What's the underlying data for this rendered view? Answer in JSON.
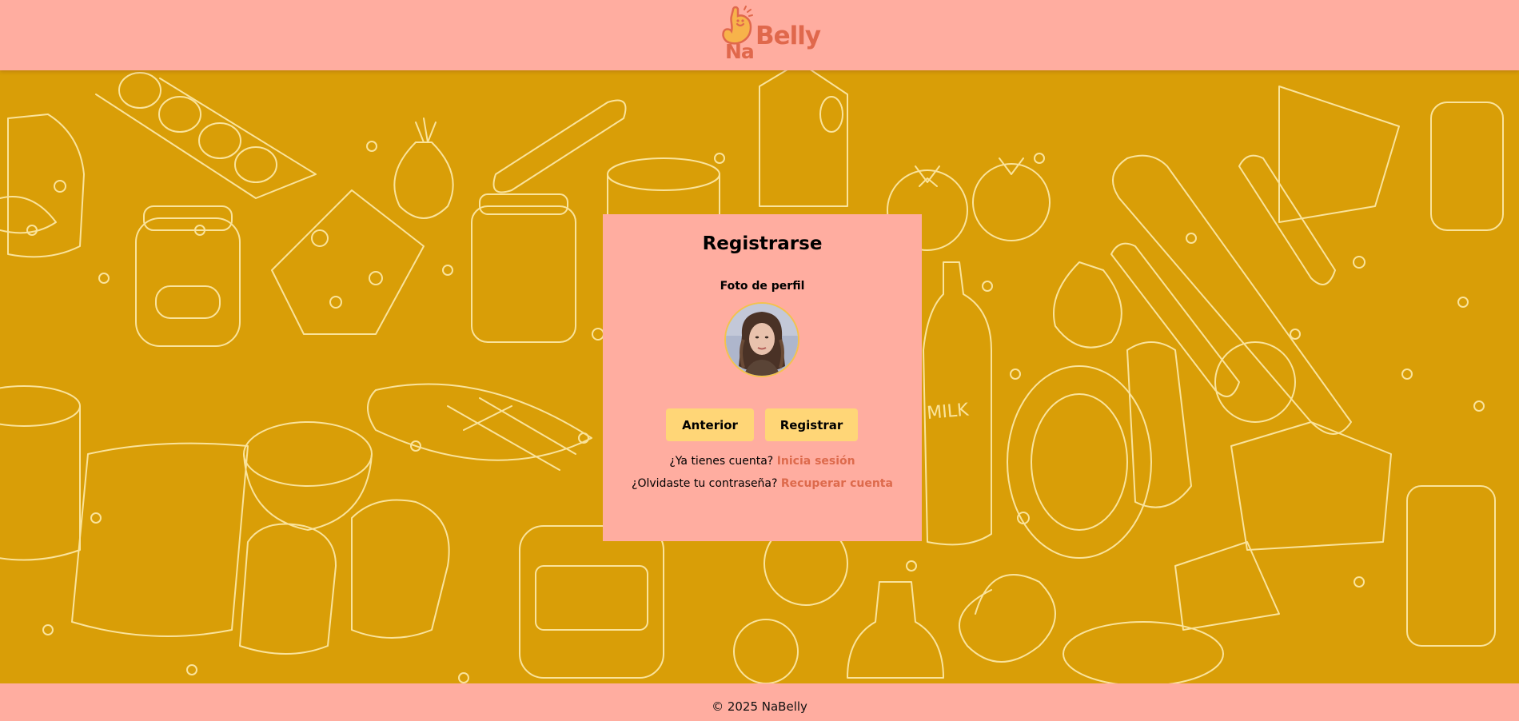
{
  "header": {
    "logo_na": "Na",
    "logo_word": "Belly"
  },
  "card": {
    "title": "Registrarse",
    "photo_label": "Foto de perfil",
    "back_button": "Anterior",
    "register_button": "Registrar",
    "have_account_text": "¿Ya tienes cuenta?",
    "login_link": "Inicia sesión",
    "forgot_text": "¿Olvidaste tu contraseña?",
    "recover_link": "Recuperar cuenta"
  },
  "footer": {
    "copyright": "© 2025 NaBelly"
  },
  "icons": {
    "logo": "stomach-mascot-icon",
    "avatar": "profile-photo"
  },
  "colors": {
    "bar_background": "#ffada0",
    "page_background": "#d99e07",
    "doodle_line": "#fde9a8",
    "button": "#ffd677",
    "link": "#dd6a4c",
    "logo": "#e0684c"
  }
}
